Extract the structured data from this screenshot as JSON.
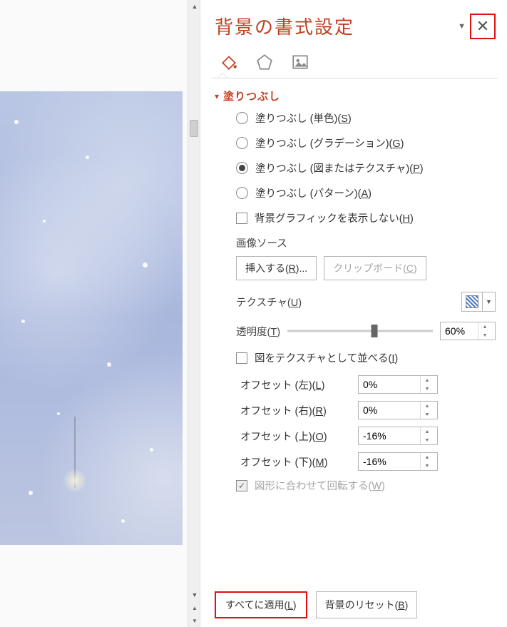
{
  "panel": {
    "title": "背景の書式設定",
    "section_fill": "塗りつぶし"
  },
  "fill_options": {
    "solid": {
      "label": "塗りつぶし (単色)(",
      "accel": "S",
      "tail": ")"
    },
    "gradient": {
      "label": "塗りつぶし (グラデーション)(",
      "accel": "G",
      "tail": ")"
    },
    "picture": {
      "label": "塗りつぶし (図またはテクスチャ)(",
      "accel": "P",
      "tail": ")"
    },
    "pattern": {
      "label": "塗りつぶし (パターン)(",
      "accel": "A",
      "tail": ")"
    },
    "hide_bg": {
      "label": "背景グラフィックを表示しない(",
      "accel": "H",
      "tail": ")"
    }
  },
  "image_source": {
    "header": "画像ソース",
    "insert": {
      "label": "挿入する(",
      "accel": "R",
      "tail": ")..."
    },
    "clipboard": {
      "label": "クリップボード(",
      "accel": "C",
      "tail": ")"
    }
  },
  "texture": {
    "label_pre": "テクスチャ(",
    "accel": "U",
    "label_post": ")"
  },
  "transparency": {
    "label_pre": "透明度(",
    "accel": "T",
    "label_post": ")",
    "value": "60%"
  },
  "tile": {
    "label_pre": "図をテクスチャとして並べる(",
    "accel": "I",
    "label_post": ")"
  },
  "offsets": {
    "left": {
      "label_pre": "オフセット (左)(",
      "accel": "L",
      "label_post": ")",
      "value": "0%"
    },
    "right": {
      "label_pre": "オフセット (右)(",
      "accel": "R",
      "label_post": ")",
      "value": "0%"
    },
    "top": {
      "label_pre": "オフセット (上)(",
      "accel": "O",
      "label_post": ")",
      "value": "-16%"
    },
    "bottom": {
      "label_pre": "オフセット (下)(",
      "accel": "M",
      "label_post": ")",
      "value": "-16%"
    }
  },
  "rotate": {
    "label_pre": "図形に合わせて回転する(",
    "accel": "W",
    "label_post": ")"
  },
  "footer": {
    "apply_all": {
      "pre": "すべてに適用(",
      "accel": "L",
      "post": ")"
    },
    "reset": {
      "pre": "背景のリセット(",
      "accel": "B",
      "post": ")"
    }
  }
}
